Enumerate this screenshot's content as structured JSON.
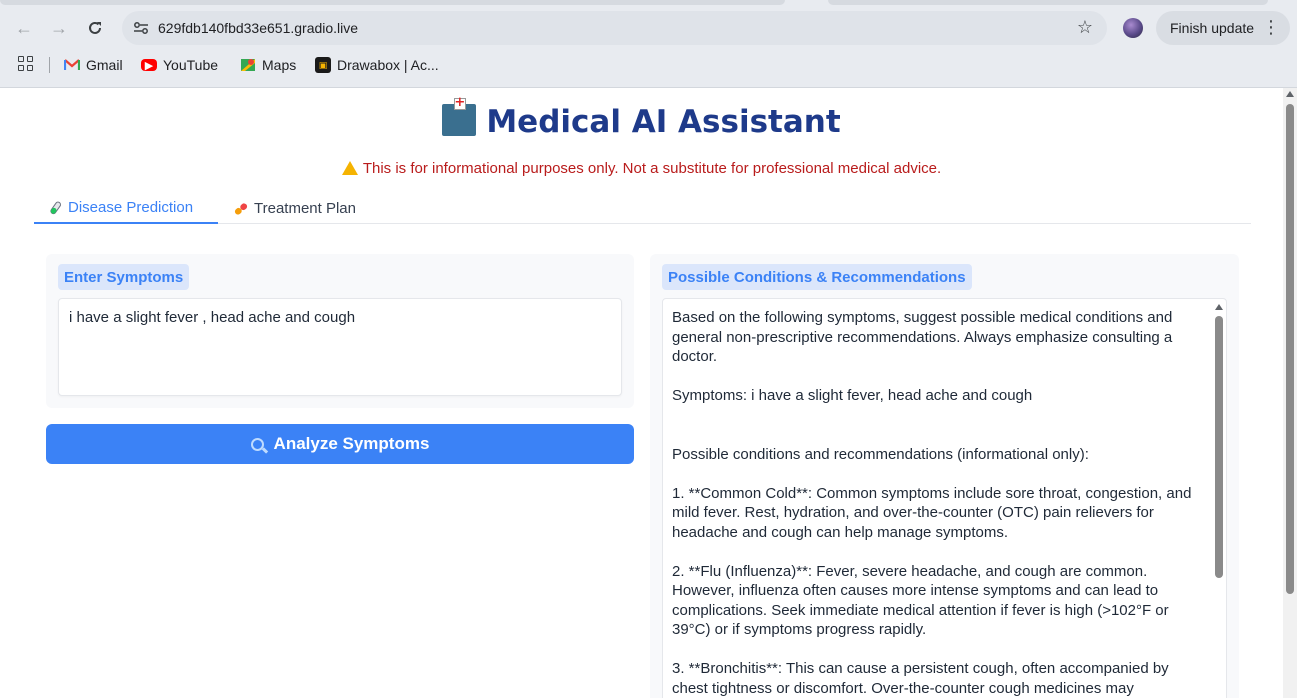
{
  "browser": {
    "url": "629fdb140fbd33e651.gradio.live",
    "finish_update_label": "Finish update",
    "bookmarks": [
      {
        "label": "Gmail",
        "icon": "gmail-icon"
      },
      {
        "label": "YouTube",
        "icon": "youtube-icon"
      },
      {
        "label": "Maps",
        "icon": "maps-icon"
      },
      {
        "label": "Drawabox | Ac...",
        "icon": "drawabox-icon"
      }
    ]
  },
  "app": {
    "title": "Medical AI Assistant",
    "title_icon": "hospital-icon",
    "disclaimer": "This is for informational purposes only. Not a substitute for professional medical advice.",
    "tabs": [
      {
        "label": "Disease Prediction",
        "icon": "test-tube-icon",
        "active": true
      },
      {
        "label": "Treatment Plan",
        "icon": "pill-icon",
        "active": false
      }
    ],
    "input": {
      "label": "Enter Symptoms",
      "value": "i have a slight fever , head ache and cough"
    },
    "analyze_button": "Analyze Symptoms",
    "output": {
      "label": "Possible Conditions & Recommendations",
      "text": "Based on the following symptoms, suggest possible medical conditions and general non-prescriptive recommendations. Always emphasize consulting a doctor.\n\nSymptoms: i have a slight fever, head ache and cough\n\n\nPossible conditions and recommendations (informational only):\n\n1. **Common Cold**: Common symptoms include sore throat, congestion, and mild fever. Rest, hydration, and over-the-counter (OTC) pain relievers for headache and cough can help manage symptoms.\n\n2. **Flu (Influenza)**: Fever, severe headache, and cough are common. However, influenza often causes more intense symptoms and can lead to complications. Seek immediate medical attention if fever is high (>102°F or 39°C) or if symptoms progress rapidly.\n\n3. **Bronchitis**: This can cause a persistent cough, often accompanied by chest tightness or discomfort. Over-the-counter cough medicines may"
    }
  },
  "colors": {
    "accent": "#3b82f6",
    "title": "#1e3a8a",
    "warning_text": "#b91c1c"
  }
}
